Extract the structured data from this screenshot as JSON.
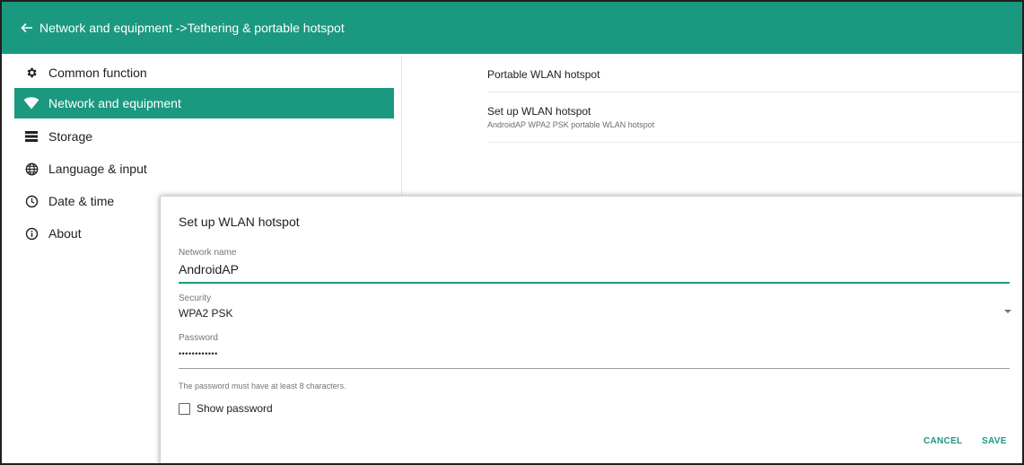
{
  "colors": {
    "accent": "#1a9980",
    "text": "#212121",
    "secondary_text": "#757575"
  },
  "appbar": {
    "back_icon": "arrow-left-icon",
    "title": "Network and equipment ->Tethering & portable hotspot"
  },
  "sidebar": {
    "items": [
      {
        "label": "Common function",
        "icon": "gear-icon",
        "active": false
      },
      {
        "label": "Network and equipment",
        "icon": "wifi-icon",
        "active": true
      },
      {
        "label": "Storage",
        "icon": "storage-icon",
        "active": false
      },
      {
        "label": "Language & input",
        "icon": "globe-icon",
        "active": false
      },
      {
        "label": "Date & time",
        "icon": "clock-icon",
        "active": false
      },
      {
        "label": "About",
        "icon": "info-icon",
        "active": false
      }
    ]
  },
  "content": {
    "portable_hotspot": {
      "title": "Portable WLAN hotspot"
    },
    "setup_hotspot": {
      "title": "Set up WLAN hotspot",
      "summary": "AndroidAP WPA2 PSK portable WLAN hotspot"
    }
  },
  "dialog": {
    "title": "Set up WLAN hotspot",
    "network_name": {
      "label": "Network name",
      "value": "AndroidAP"
    },
    "security": {
      "label": "Security",
      "value": "WPA2 PSK"
    },
    "password": {
      "label": "Password",
      "value": "••••••••••••"
    },
    "hint": "The password must have at least 8 characters.",
    "show_password": {
      "label": "Show password",
      "checked": false
    },
    "cancel_label": "CANCEL",
    "save_label": "SAVE"
  }
}
